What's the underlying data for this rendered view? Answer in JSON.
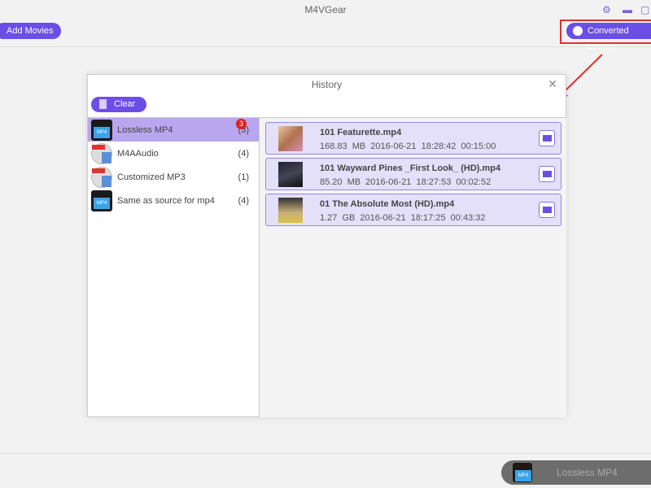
{
  "app": {
    "title": "M4VGear"
  },
  "toolbar": {
    "add_movies": "Add Movies",
    "converted_movies": "Converted Movies"
  },
  "history": {
    "title": "History",
    "clear_label": "Clear",
    "categories": [
      {
        "label": "Lossless MP4",
        "count": "(3)",
        "badge": "3",
        "icon": "video-clapper-icon"
      },
      {
        "label": "M4AAudio",
        "count": "(4)",
        "icon": "audio-disc-icon"
      },
      {
        "label": "Customized MP3",
        "count": "(1)",
        "icon": "audio-disc-icon"
      },
      {
        "label": "Same as source for mp4",
        "count": "(4)",
        "icon": "video-clapper-icon"
      }
    ],
    "items": [
      {
        "name": "101 Featurette.mp4",
        "size": "168.83 MB",
        "date": "2016-06-21",
        "time": "18:28:42",
        "duration": "00:15:00"
      },
      {
        "name": "101 Wayward Pines _First Look_ (HD).mp4",
        "size": "85.20 MB",
        "date": "2016-06-21",
        "time": "18:27:53",
        "duration": "00:02:52"
      },
      {
        "name": "01 The Absolute Most (HD).mp4",
        "size": "1.27 GB",
        "date": "2016-06-21",
        "time": "18:17:25",
        "duration": "00:43:32"
      }
    ]
  },
  "output_format": "Lossless MP4"
}
